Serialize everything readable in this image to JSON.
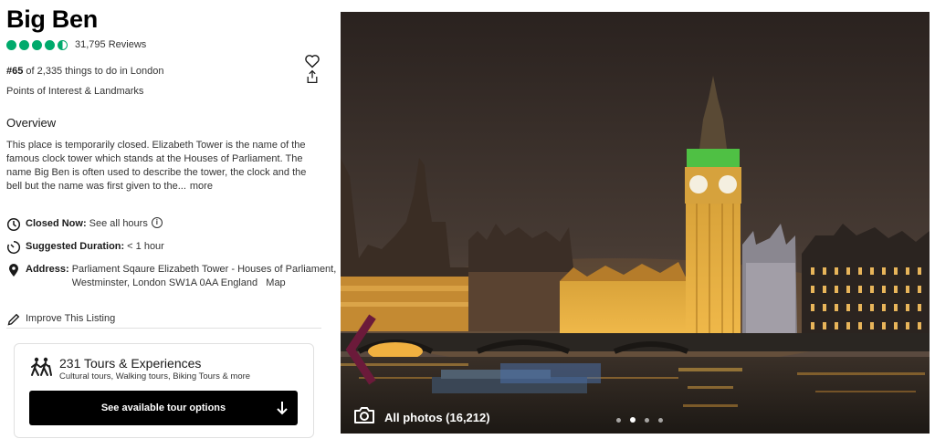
{
  "title": "Big Ben",
  "rating": {
    "bubbles": 4.5,
    "reviews": "31,795 Reviews",
    "color": "#00aa6c"
  },
  "rank": {
    "number": "#65",
    "rest": "of 2,335 things to do in London"
  },
  "category": "Points of Interest & Landmarks",
  "overview": {
    "heading": "Overview",
    "text": "This place is temporarily closed. Elizabeth Tower is the name of the famous clock tower which stands at the Houses of Parliament. The name Big Ben is often used to describe the tower, the clock and the bell but the name was first given to the...",
    "more": "more"
  },
  "hours": {
    "label": "Closed Now:",
    "value": "See all hours"
  },
  "duration": {
    "label": "Suggested Duration:",
    "value": "< 1 hour"
  },
  "address": {
    "label": "Address:",
    "value": "Parliament Sqaure Elizabeth Tower - Houses of Parliament, Westminster, London SW1A 0AA England",
    "map_link": "Map"
  },
  "improve": "Improve This Listing",
  "tours": {
    "title": "231 Tours & Experiences",
    "subtitle": "Cultural tours, Walking tours, Biking Tours & more",
    "button": "See available tour options"
  },
  "photo": {
    "all_photos": "All photos (16,212)",
    "dots_count": 4,
    "active_dot": 2
  },
  "icons": [
    "heart-icon",
    "share-icon",
    "clock-icon",
    "timer-icon",
    "location-pin-icon",
    "pencil-icon",
    "info-icon",
    "hiker-icon",
    "arrow-down-icon",
    "camera-icon",
    "chevron-left-icon"
  ]
}
